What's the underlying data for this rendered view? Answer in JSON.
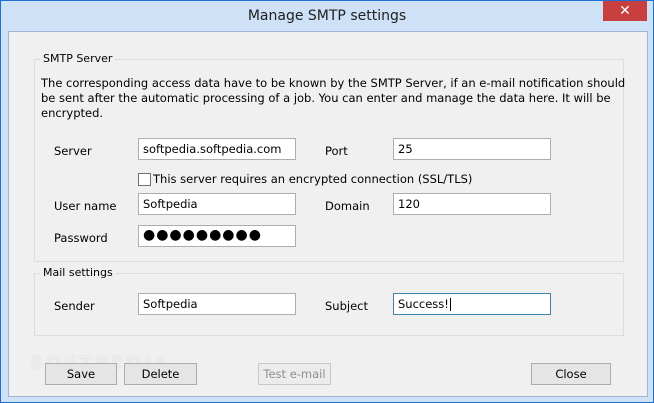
{
  "window": {
    "title": "Manage SMTP settings",
    "close_glyph": "✕"
  },
  "smtp_server": {
    "legend": "SMTP Server",
    "description": "The corresponding access data have to be known by the SMTP Server, if an e-mail notification should be sent after the automatic processing of a job. You can enter and manage the data here. It will be encrypted.",
    "server_label": "Server",
    "server_value": "softpedia.softpedia.com",
    "port_label": "Port",
    "port_value": "25",
    "ssl_label": "This server requires an encrypted connection (SSL/TLS)",
    "ssl_checked": false,
    "username_label": "User name",
    "username_value": "Softpedia",
    "domain_label": "Domain",
    "domain_value": "120",
    "password_label": "Password",
    "password_value": "●●●●●●●●●"
  },
  "mail_settings": {
    "legend": "Mail settings",
    "sender_label": "Sender",
    "sender_value": "Softpedia",
    "subject_label": "Subject",
    "subject_value": "Success!"
  },
  "buttons": {
    "save": "Save",
    "delete": "Delete",
    "test_email": "Test e-mail",
    "close": "Close"
  },
  "watermark": "SOFTPEDIA"
}
